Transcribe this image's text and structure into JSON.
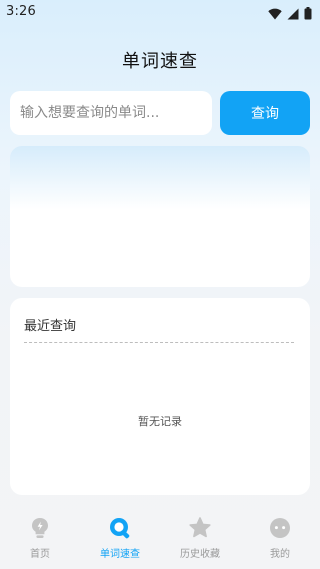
{
  "status_bar": {
    "time": "3:26",
    "icons": [
      "wifi-icon",
      "signal-icon",
      "battery-icon"
    ]
  },
  "header": {
    "title": "单词速查"
  },
  "search": {
    "placeholder": "输入想要查询的单词...",
    "value": "",
    "button_label": "查询"
  },
  "recent": {
    "title": "最近查询",
    "empty_text": "暂无记录"
  },
  "tab_bar": {
    "tabs": [
      {
        "label": "首页",
        "icon": "lightbulb-icon",
        "active": false
      },
      {
        "label": "单词速查",
        "icon": "search-icon",
        "active": true
      },
      {
        "label": "历史收藏",
        "icon": "star-icon",
        "active": false
      },
      {
        "label": "我的",
        "icon": "profile-icon",
        "active": false
      }
    ]
  },
  "colors": {
    "accent": "#12a3f5",
    "inactive": "#c4c4c4",
    "label_inactive": "#9a9a9a"
  }
}
